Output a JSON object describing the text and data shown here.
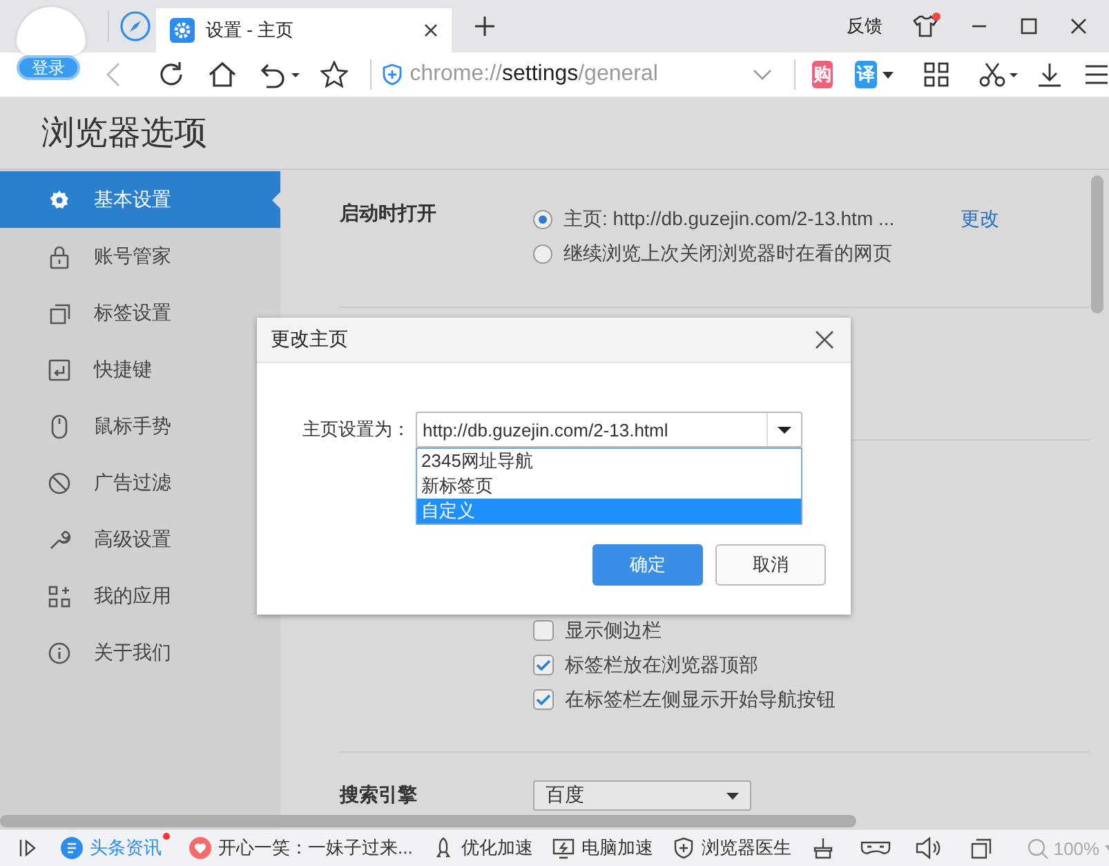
{
  "tab_bar": {
    "tab_title": "设置 - 主页",
    "feedback": "反馈",
    "skin_badge": true
  },
  "login_button": "登录",
  "toolbar": {
    "back_disabled": true,
    "address": {
      "scheme": "chrome://",
      "host": "settings",
      "path": "/general"
    },
    "shop_label": "购",
    "translate_label": "译"
  },
  "page": {
    "title": "浏览器选项"
  },
  "sidebar": {
    "items": [
      {
        "label": "基本设置",
        "selected": true
      },
      {
        "label": "账号管家",
        "selected": false
      },
      {
        "label": "标签设置",
        "selected": false
      },
      {
        "label": "快捷键",
        "selected": false
      },
      {
        "label": "鼠标手势",
        "selected": false
      },
      {
        "label": "广告过滤",
        "selected": false
      },
      {
        "label": "高级设置",
        "selected": false
      },
      {
        "label": "我的应用",
        "selected": false
      },
      {
        "label": "关于我们",
        "selected": false
      }
    ]
  },
  "startup": {
    "label": "启动时打开",
    "change_link": "更改",
    "options": [
      {
        "label": "主页: http://db.guzejin.com/2-13.htm ...",
        "selected": true
      },
      {
        "label": "继续浏览上次关闭浏览器时在看的网页",
        "selected": false
      }
    ]
  },
  "interface": {
    "options": [
      {
        "label": "显示侧边栏",
        "checked": false
      },
      {
        "label": "标签栏放在浏览器顶部",
        "checked": true
      },
      {
        "label": "在标签栏左侧显示开始导航按钮",
        "checked": true
      }
    ]
  },
  "search_engine": {
    "label": "搜索引擎",
    "value": "百度"
  },
  "dialog": {
    "title": "更改主页",
    "field_label": "主页设置为：",
    "value": "http://db.guzejin.com/2-13.html",
    "options": [
      {
        "label": "2345网址导航",
        "selected": false
      },
      {
        "label": "新标签页",
        "selected": false
      },
      {
        "label": "自定义",
        "selected": true
      }
    ],
    "buttons": [
      {
        "label": "确定",
        "kind": "primary"
      },
      {
        "label": "取消",
        "kind": "secondary"
      }
    ]
  },
  "status_bar": {
    "items": [
      {
        "kind": "news",
        "label": "头条资讯",
        "badge": true
      },
      {
        "kind": "joke",
        "label": "开心一笑：一妹子过来...",
        "badge": false
      },
      {
        "kind": "boost",
        "label": "优化加速",
        "badge": false
      },
      {
        "kind": "pc",
        "label": "电脑加速",
        "badge": false
      },
      {
        "kind": "doctor",
        "label": "浏览器医生",
        "badge": false
      }
    ],
    "zoom": "100%"
  }
}
